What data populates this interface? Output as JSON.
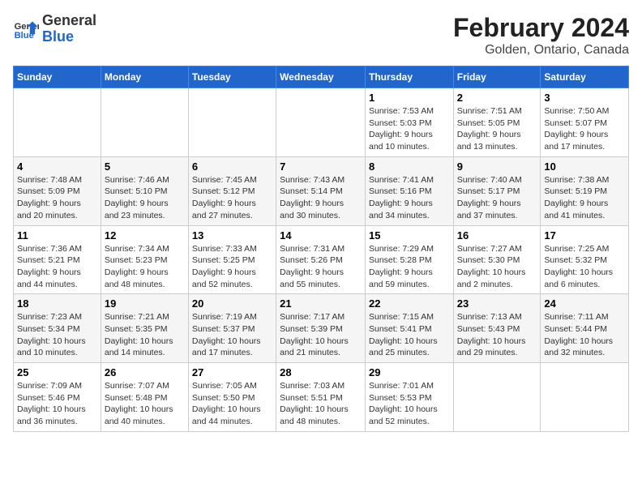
{
  "header": {
    "logo_line1": "General",
    "logo_line2": "Blue",
    "title": "February 2024",
    "subtitle": "Golden, Ontario, Canada"
  },
  "days_of_week": [
    "Sunday",
    "Monday",
    "Tuesday",
    "Wednesday",
    "Thursday",
    "Friday",
    "Saturday"
  ],
  "weeks": [
    [
      {
        "num": "",
        "info": ""
      },
      {
        "num": "",
        "info": ""
      },
      {
        "num": "",
        "info": ""
      },
      {
        "num": "",
        "info": ""
      },
      {
        "num": "1",
        "info": "Sunrise: 7:53 AM\nSunset: 5:03 PM\nDaylight: 9 hours\nand 10 minutes."
      },
      {
        "num": "2",
        "info": "Sunrise: 7:51 AM\nSunset: 5:05 PM\nDaylight: 9 hours\nand 13 minutes."
      },
      {
        "num": "3",
        "info": "Sunrise: 7:50 AM\nSunset: 5:07 PM\nDaylight: 9 hours\nand 17 minutes."
      }
    ],
    [
      {
        "num": "4",
        "info": "Sunrise: 7:48 AM\nSunset: 5:09 PM\nDaylight: 9 hours\nand 20 minutes."
      },
      {
        "num": "5",
        "info": "Sunrise: 7:46 AM\nSunset: 5:10 PM\nDaylight: 9 hours\nand 23 minutes."
      },
      {
        "num": "6",
        "info": "Sunrise: 7:45 AM\nSunset: 5:12 PM\nDaylight: 9 hours\nand 27 minutes."
      },
      {
        "num": "7",
        "info": "Sunrise: 7:43 AM\nSunset: 5:14 PM\nDaylight: 9 hours\nand 30 minutes."
      },
      {
        "num": "8",
        "info": "Sunrise: 7:41 AM\nSunset: 5:16 PM\nDaylight: 9 hours\nand 34 minutes."
      },
      {
        "num": "9",
        "info": "Sunrise: 7:40 AM\nSunset: 5:17 PM\nDaylight: 9 hours\nand 37 minutes."
      },
      {
        "num": "10",
        "info": "Sunrise: 7:38 AM\nSunset: 5:19 PM\nDaylight: 9 hours\nand 41 minutes."
      }
    ],
    [
      {
        "num": "11",
        "info": "Sunrise: 7:36 AM\nSunset: 5:21 PM\nDaylight: 9 hours\nand 44 minutes."
      },
      {
        "num": "12",
        "info": "Sunrise: 7:34 AM\nSunset: 5:23 PM\nDaylight: 9 hours\nand 48 minutes."
      },
      {
        "num": "13",
        "info": "Sunrise: 7:33 AM\nSunset: 5:25 PM\nDaylight: 9 hours\nand 52 minutes."
      },
      {
        "num": "14",
        "info": "Sunrise: 7:31 AM\nSunset: 5:26 PM\nDaylight: 9 hours\nand 55 minutes."
      },
      {
        "num": "15",
        "info": "Sunrise: 7:29 AM\nSunset: 5:28 PM\nDaylight: 9 hours\nand 59 minutes."
      },
      {
        "num": "16",
        "info": "Sunrise: 7:27 AM\nSunset: 5:30 PM\nDaylight: 10 hours\nand 2 minutes."
      },
      {
        "num": "17",
        "info": "Sunrise: 7:25 AM\nSunset: 5:32 PM\nDaylight: 10 hours\nand 6 minutes."
      }
    ],
    [
      {
        "num": "18",
        "info": "Sunrise: 7:23 AM\nSunset: 5:34 PM\nDaylight: 10 hours\nand 10 minutes."
      },
      {
        "num": "19",
        "info": "Sunrise: 7:21 AM\nSunset: 5:35 PM\nDaylight: 10 hours\nand 14 minutes."
      },
      {
        "num": "20",
        "info": "Sunrise: 7:19 AM\nSunset: 5:37 PM\nDaylight: 10 hours\nand 17 minutes."
      },
      {
        "num": "21",
        "info": "Sunrise: 7:17 AM\nSunset: 5:39 PM\nDaylight: 10 hours\nand 21 minutes."
      },
      {
        "num": "22",
        "info": "Sunrise: 7:15 AM\nSunset: 5:41 PM\nDaylight: 10 hours\nand 25 minutes."
      },
      {
        "num": "23",
        "info": "Sunrise: 7:13 AM\nSunset: 5:43 PM\nDaylight: 10 hours\nand 29 minutes."
      },
      {
        "num": "24",
        "info": "Sunrise: 7:11 AM\nSunset: 5:44 PM\nDaylight: 10 hours\nand 32 minutes."
      }
    ],
    [
      {
        "num": "25",
        "info": "Sunrise: 7:09 AM\nSunset: 5:46 PM\nDaylight: 10 hours\nand 36 minutes."
      },
      {
        "num": "26",
        "info": "Sunrise: 7:07 AM\nSunset: 5:48 PM\nDaylight: 10 hours\nand 40 minutes."
      },
      {
        "num": "27",
        "info": "Sunrise: 7:05 AM\nSunset: 5:50 PM\nDaylight: 10 hours\nand 44 minutes."
      },
      {
        "num": "28",
        "info": "Sunrise: 7:03 AM\nSunset: 5:51 PM\nDaylight: 10 hours\nand 48 minutes."
      },
      {
        "num": "29",
        "info": "Sunrise: 7:01 AM\nSunset: 5:53 PM\nDaylight: 10 hours\nand 52 minutes."
      },
      {
        "num": "",
        "info": ""
      },
      {
        "num": "",
        "info": ""
      }
    ]
  ]
}
